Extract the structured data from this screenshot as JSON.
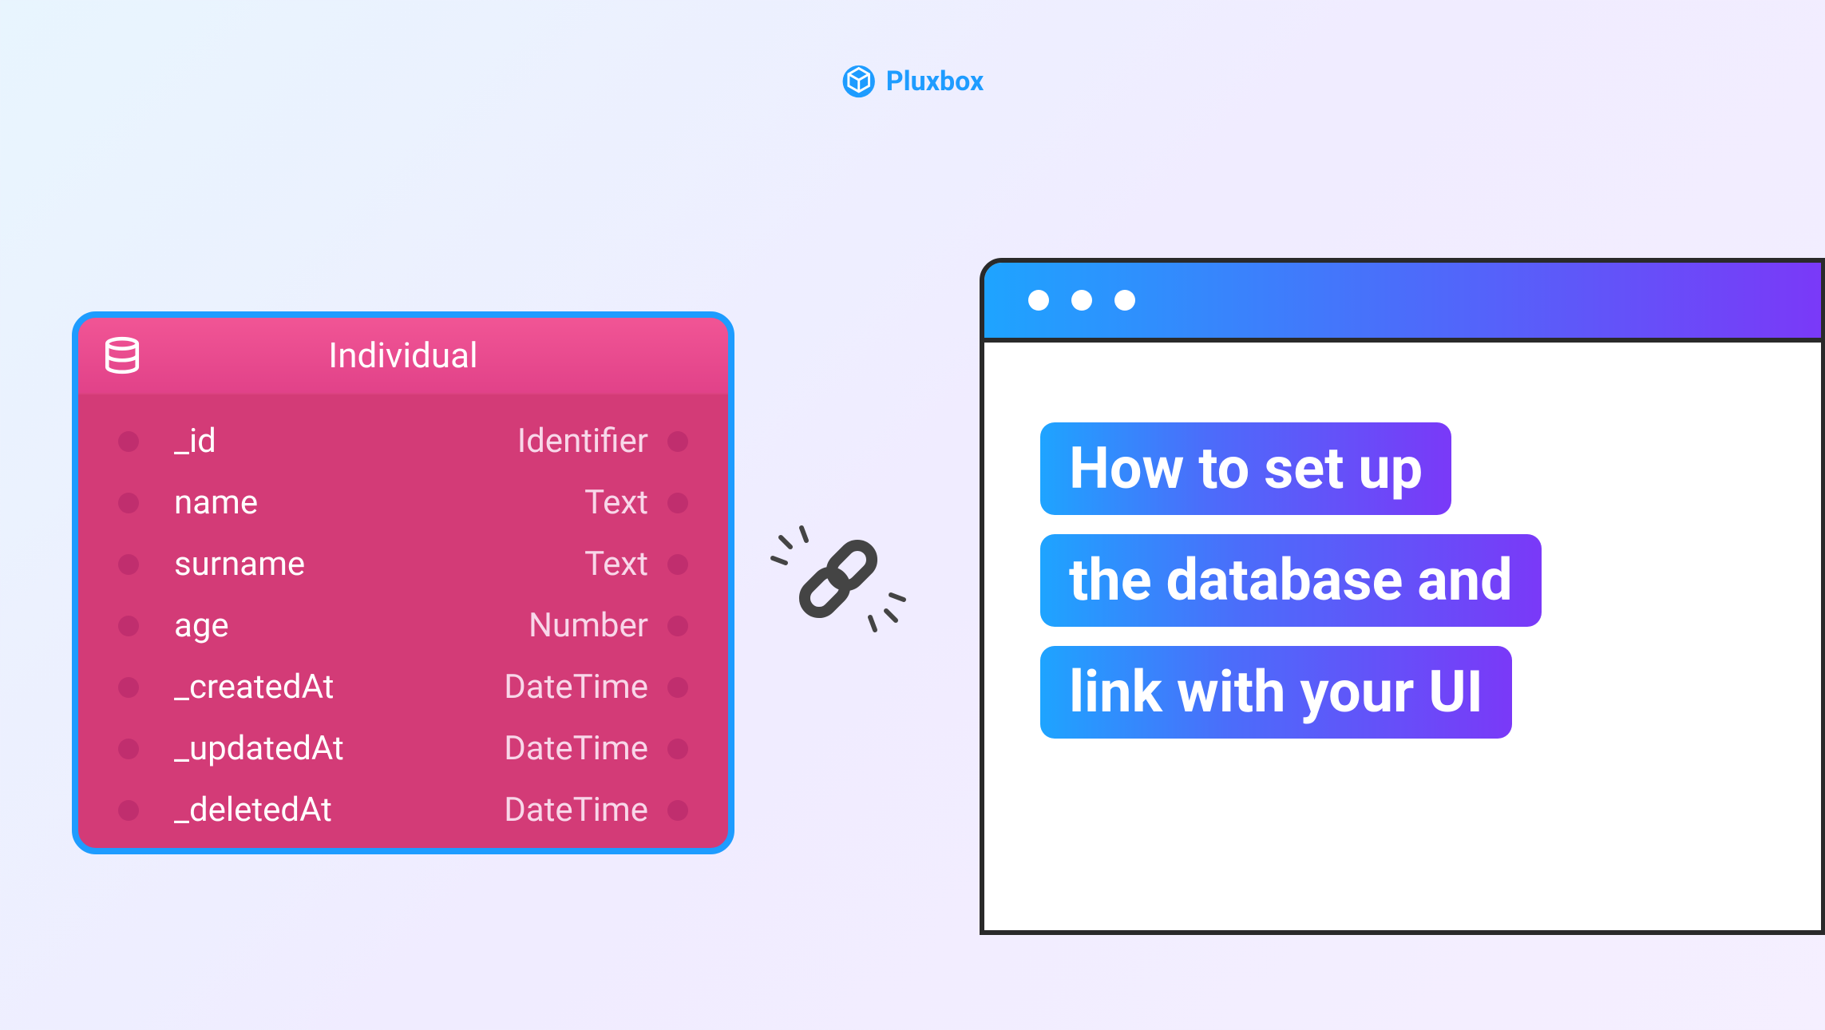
{
  "brand": {
    "name": "Pluxbox"
  },
  "database": {
    "title": "Individual",
    "fields": [
      {
        "name": "_id",
        "type": "Identifier"
      },
      {
        "name": "name",
        "type": "Text"
      },
      {
        "name": "surname",
        "type": "Text"
      },
      {
        "name": "age",
        "type": "Number"
      },
      {
        "name": "_createdAt",
        "type": "DateTime"
      },
      {
        "name": "_updatedAt",
        "type": "DateTime"
      },
      {
        "name": "_deletedAt",
        "type": "DateTime"
      }
    ]
  },
  "title": {
    "line1": "How to set up",
    "line2": "the database and",
    "line3": "link with your UI"
  }
}
